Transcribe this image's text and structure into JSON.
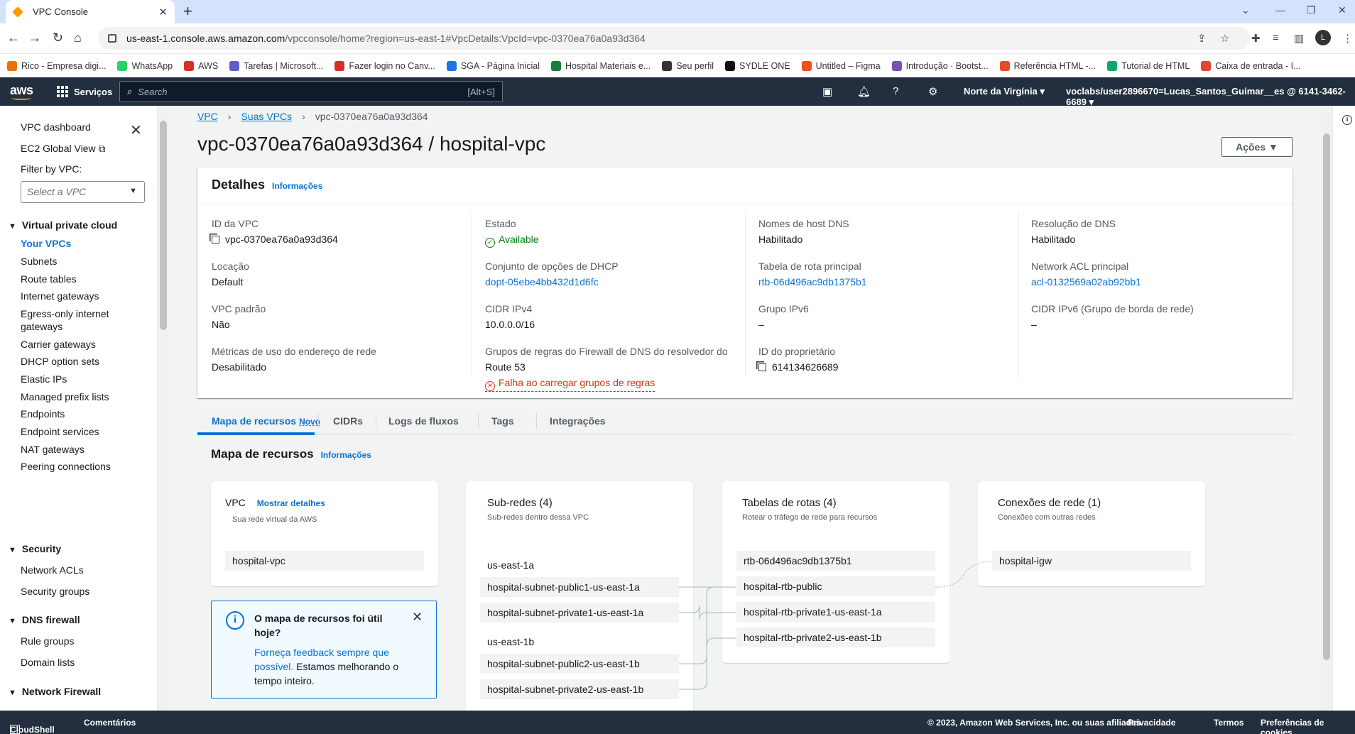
{
  "browser": {
    "tab_title": "VPC Console",
    "url_host": "us-east-1.console.aws.amazon.com",
    "url_path": "/vpcconsole/home?region=us-east-1#VpcDetails:VpcId=vpc-0370ea76a0a93d364",
    "avatar_letter": "L",
    "bookmarks": [
      {
        "label": "Rico - Empresa digi...",
        "color": "#e8710a"
      },
      {
        "label": "WhatsApp",
        "color": "#25d366"
      },
      {
        "label": "AWS",
        "color": "#d93025"
      },
      {
        "label": "Tarefas | Microsoft...",
        "color": "#5b5fc7"
      },
      {
        "label": "Fazer login no Canv...",
        "color": "#d93025"
      },
      {
        "label": "SGA - Página Inicial",
        "color": "#1a73e8"
      },
      {
        "label": "Hospital Materiais e...",
        "color": "#188038"
      },
      {
        "label": "Seu perfil",
        "color": "#333333"
      },
      {
        "label": "SYDLE ONE",
        "color": "#111111"
      },
      {
        "label": "Untitled – Figma",
        "color": "#f24e1e"
      },
      {
        "label": "Introdução · Bootst...",
        "color": "#7952b3"
      },
      {
        "label": "Referência HTML -...",
        "color": "#e44d26"
      },
      {
        "label": "Tutorial de HTML",
        "color": "#04aa6d"
      },
      {
        "label": "Caixa de entrada - I...",
        "color": "#ea4335"
      }
    ]
  },
  "aws_nav": {
    "logo": "aws",
    "services": "Serviços",
    "search_placeholder": "Search",
    "search_shortcut": "[Alt+S]",
    "region": "Norte da Virgínia",
    "account": "voclabs/user2896670=Lucas_Santos_Guimar__es @ 6141-3462-6689"
  },
  "sidebar": {
    "vpc_dashboard": "VPC dashboard",
    "ec2_global_view": "EC2 Global View",
    "filter_label": "Filter by VPC:",
    "filter_placeholder": "Select a VPC",
    "sections": {
      "vpc": "Virtual private cloud",
      "security": "Security",
      "dns_firewall": "DNS firewall",
      "network_firewall": "Network Firewall"
    },
    "vpc_items": [
      "Your VPCs",
      "Subnets",
      "Route tables",
      "Internet gateways",
      "Egress-only internet",
      "gateways",
      "Carrier gateways",
      "DHCP option sets",
      "Elastic IPs",
      "Managed prefix lists",
      "Endpoints",
      "Endpoint services",
      "NAT gateways",
      "Peering connections"
    ],
    "security_items": [
      "Network ACLs",
      "Security groups"
    ],
    "dns_items": [
      "Rule groups",
      "Domain lists"
    ]
  },
  "breadcrumb": [
    "VPC",
    "Suas VPCs",
    "vpc-0370ea76a0a93d364"
  ],
  "page_title": "vpc-0370ea76a0a93d364 / hospital-vpc",
  "actions_label": "Ações",
  "details": {
    "title": "Detalhes",
    "info": "Informações",
    "vpc_id_label": "ID da VPC",
    "vpc_id": "vpc-0370ea76a0a93d364",
    "tenancy_label": "Locação",
    "tenancy": "Default",
    "default_vpc_label": "VPC padrão",
    "default_vpc": "Não",
    "metrics_label": "Métricas de uso do endereço de rede",
    "metrics": "Desabilitado",
    "state_label": "Estado",
    "state": "Available",
    "dhcp_label": "Conjunto de opções de DHCP",
    "dhcp": "dopt-05ebe4bb432d1d6fc",
    "cidr_label": "CIDR IPv4",
    "cidr": "10.0.0.0/16",
    "dns_fw_label_1": "Grupos de regras do Firewall de DNS do resolvedor do",
    "dns_fw_label_2": "Route 53",
    "dns_fw_error": "Falha ao carregar grupos de regras",
    "dns_hostnames_label": "Nomes de host DNS",
    "dns_hostnames": "Habilitado",
    "main_rt_label": "Tabela de rota principal",
    "main_rt": "rtb-06d496ac9db1375b1",
    "ipv6_pool_label": "Grupo IPv6",
    "ipv6_pool": "–",
    "owner_label": "ID do proprietário",
    "owner": "614134626689",
    "dns_resolution_label": "Resolução de DNS",
    "dns_resolution": "Habilitado",
    "main_acl_label": "Network ACL principal",
    "main_acl": "acl-0132569a02ab92bb1",
    "ipv6_cidr_label": "CIDR IPv6 (Grupo de borda de rede)",
    "ipv6_cidr": "–"
  },
  "tabs": {
    "resource_map": "Mapa de recursos",
    "novo": "Novo",
    "cidrs": "CIDRs",
    "flow_logs": "Logs de fluxos",
    "tags": "Tags",
    "integrations": "Integrações"
  },
  "resource_map": {
    "title": "Mapa de recursos",
    "info": "Informações",
    "vpc_card": {
      "title": "VPC",
      "show_details": "Mostrar detalhes",
      "subtitle": "Sua rede virtual da AWS",
      "name": "hospital-vpc"
    },
    "subnets_card": {
      "title": "Sub-redes (4)",
      "subtitle": "Sub-redes dentro dessa VPC",
      "az1": "us-east-1a",
      "az2": "us-east-1b",
      "items": [
        "hospital-subnet-public1-us-east-1a",
        "hospital-subnet-private1-us-east-1a",
        "hospital-subnet-public2-us-east-1b",
        "hospital-subnet-private2-us-east-1b"
      ]
    },
    "routes_card": {
      "title": "Tabelas de rotas (4)",
      "subtitle": "Rotear o tráfego de rede para recursos",
      "items": [
        "rtb-06d496ac9db1375b1",
        "hospital-rtb-public",
        "hospital-rtb-private1-us-east-1a",
        "hospital-rtb-private2-us-east-1b"
      ]
    },
    "connections_card": {
      "title": "Conexões de rede (1)",
      "subtitle": "Conexões com outras redes",
      "items": [
        "hospital-igw"
      ]
    }
  },
  "feedback": {
    "title": "O mapa de recursos foi útil hoje?",
    "link": "Forneça feedback sempre que possível.",
    "text": " Estamos melhorando o tempo inteiro."
  },
  "footer": {
    "cloudshell": "CloudShell",
    "comments": "Comentários",
    "copyright": "© 2023, Amazon Web Services, Inc. ou suas afiliadas.",
    "privacy": "Privacidade",
    "terms": "Termos",
    "cookies": "Preferências de cookies"
  }
}
